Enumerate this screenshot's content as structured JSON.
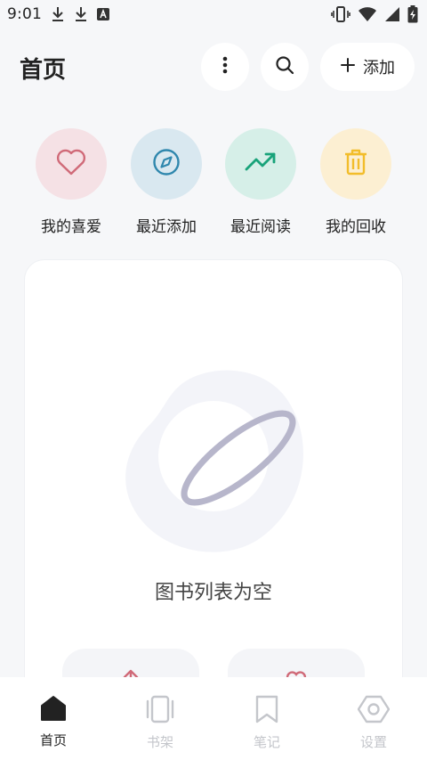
{
  "status_bar": {
    "time": "9:01",
    "left_icons": [
      "download-icon",
      "download-icon",
      "font-icon"
    ],
    "right_icons": [
      "vibrate-icon",
      "wifi-icon",
      "signal-icon",
      "battery-charging-icon"
    ]
  },
  "header": {
    "title": "首页",
    "add_label": "添加"
  },
  "quick_actions": [
    {
      "label": "我的喜爱",
      "icon": "heart-icon",
      "bg": "#f5e1e5",
      "color": "#d06a78"
    },
    {
      "label": "最近添加",
      "icon": "compass-icon",
      "bg": "#d9e8f0",
      "color": "#2f87ad"
    },
    {
      "label": "最近阅读",
      "icon": "trending-up-icon",
      "bg": "#d6efe8",
      "color": "#19a37a"
    },
    {
      "label": "我的回收",
      "icon": "trash-icon",
      "bg": "#fcefd2",
      "color": "#f2bd2b"
    }
  ],
  "empty_state": {
    "text": "图书列表为空"
  },
  "bottom_nav": [
    {
      "label": "首页",
      "icon": "home-icon",
      "active": true
    },
    {
      "label": "书架",
      "icon": "bookshelf-icon",
      "active": false
    },
    {
      "label": "笔记",
      "icon": "bookmark-icon",
      "active": false
    },
    {
      "label": "设置",
      "icon": "settings-icon",
      "active": false
    }
  ],
  "colors": {
    "background": "#f6f7f9",
    "nav_active": "#222222",
    "nav_inactive": "#c4c6cb",
    "text_primary": "#222222"
  }
}
